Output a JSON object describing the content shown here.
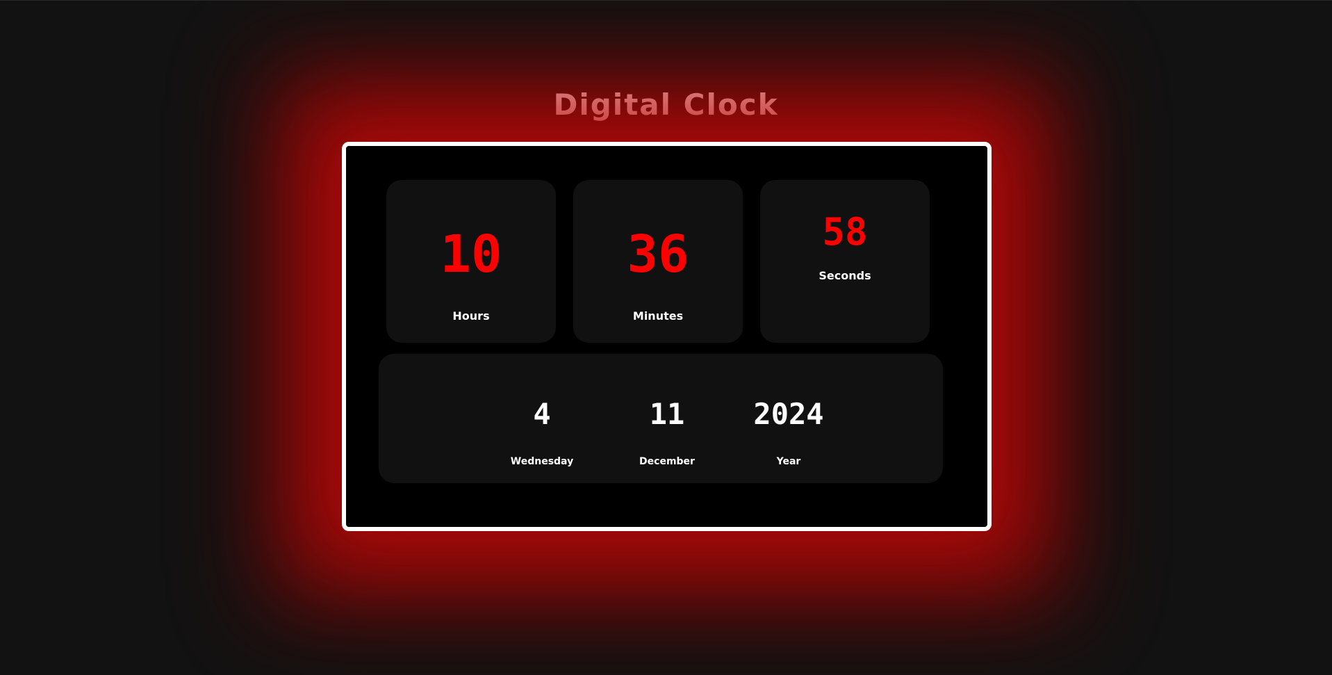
{
  "page": {
    "title": "Digital Clock"
  },
  "time": {
    "hours": {
      "value": "10",
      "label": "Hours"
    },
    "minutes": {
      "value": "36",
      "label": "Minutes"
    },
    "seconds": {
      "value": "58",
      "label": "Seconds"
    }
  },
  "date": {
    "day": {
      "value": "4",
      "label": "Wednesday"
    },
    "month": {
      "value": "11",
      "label": "December"
    },
    "year": {
      "value": "2024",
      "label": "Year"
    }
  },
  "colors": {
    "background": "#131212",
    "frame_border": "#ffffff",
    "frame_fill": "#000000",
    "tile_fill": "#111111",
    "time_digits": "#ff0000",
    "glow": "#c80a0a",
    "text": "#ffffff"
  }
}
